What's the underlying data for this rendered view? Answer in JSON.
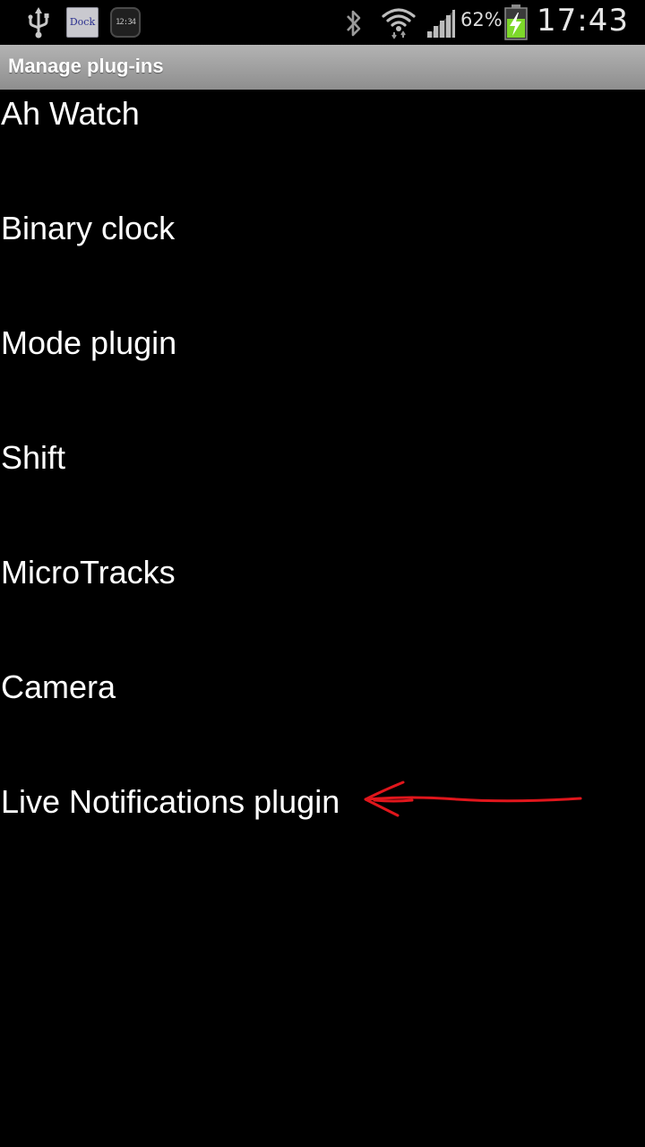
{
  "status_bar": {
    "notification_icons": [
      "usb-icon",
      "dock-app-icon",
      "clock-widget-icon"
    ],
    "dock_icon_text": "Dock",
    "clock_icon_text": "12:34",
    "system_icons": [
      "bluetooth-icon",
      "wifi-icon",
      "signal-icon",
      "battery-charging-icon"
    ],
    "battery_percent": "62%",
    "time": "17:43"
  },
  "title_bar": {
    "title": "Manage plug-ins"
  },
  "plugins": {
    "items": [
      {
        "label": "Ah Watch"
      },
      {
        "label": "Binary clock"
      },
      {
        "label": "Mode plugin"
      },
      {
        "label": "Shift"
      },
      {
        "label": "MicroTracks"
      },
      {
        "label": "Camera"
      },
      {
        "label": "Live Notifications plugin"
      }
    ]
  },
  "annotation": {
    "type": "hand-drawn-arrow",
    "color": "#e0161c",
    "points_to": "Live Notifications plugin"
  },
  "colors": {
    "background": "#000000",
    "title_bar_top": "#b3b3b3",
    "title_bar_bottom": "#8e8e8e",
    "text": "#ffffff",
    "battery_fill": "#7dd82a"
  }
}
